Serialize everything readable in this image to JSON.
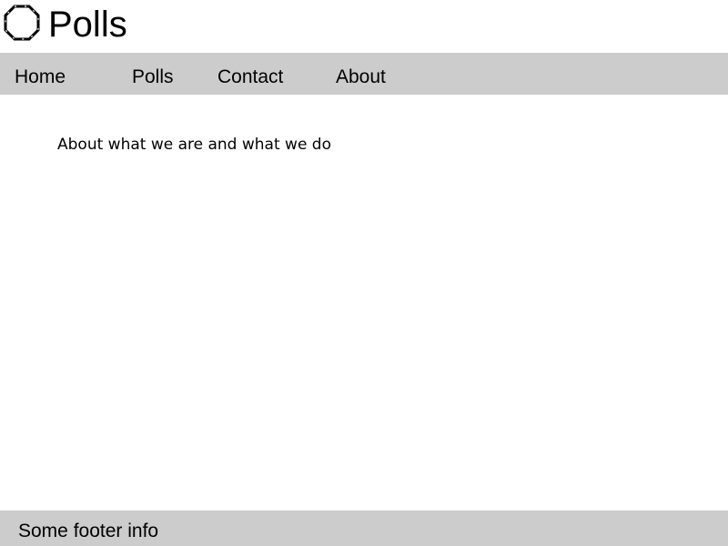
{
  "header": {
    "logo_icon": "octagon-logo-icon",
    "title": "Polls"
  },
  "nav": {
    "items": [
      {
        "label": "Home"
      },
      {
        "label": "Polls"
      },
      {
        "label": "Contact"
      },
      {
        "label": "About"
      }
    ]
  },
  "main": {
    "text": "About what we are and what we do"
  },
  "footer": {
    "text": "Some footer info"
  },
  "colors": {
    "bar_background": "#cccccc",
    "page_background": "#ffffff",
    "text": "#000000"
  }
}
